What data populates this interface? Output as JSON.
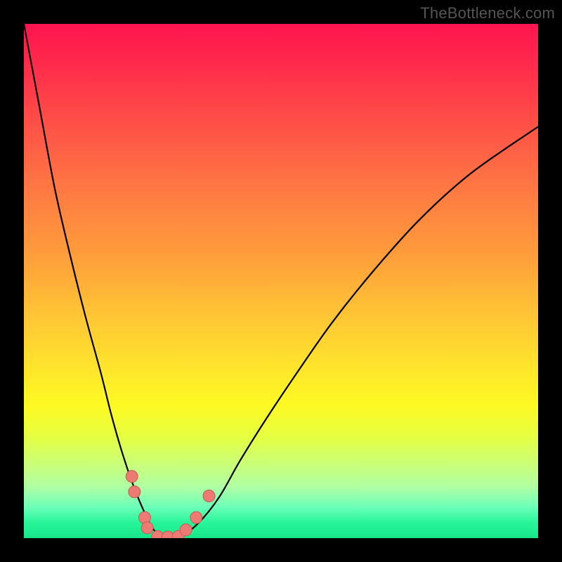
{
  "watermark": "TheBottleneck.com",
  "colors": {
    "page_bg": "#000000",
    "gradient_top": "#ff144f",
    "gradient_bottom": "#16e789",
    "curve": "#000000",
    "marker_fill": "#ed7b74",
    "marker_stroke": "#c85a55",
    "watermark": "#555555"
  },
  "chart_data": {
    "type": "line",
    "title": "",
    "xlabel": "",
    "ylabel": "",
    "xlim": [
      0,
      100
    ],
    "ylim": [
      0,
      100
    ],
    "grid": false,
    "series": [
      {
        "name": "bottleneck-curve",
        "x": [
          0,
          3,
          6,
          9,
          12,
          15,
          17,
          19,
          21,
          23,
          25,
          27,
          30,
          34,
          38,
          42,
          47,
          53,
          60,
          68,
          77,
          87,
          100
        ],
        "values": [
          100,
          84,
          68,
          55,
          43,
          32,
          24,
          17,
          11,
          6,
          2,
          0,
          0,
          3,
          8,
          15,
          23,
          32,
          42,
          52,
          62,
          71,
          80
        ]
      }
    ],
    "markers": [
      {
        "x": 21.0,
        "y": 12.0
      },
      {
        "x": 21.5,
        "y": 9.0
      },
      {
        "x": 23.5,
        "y": 4.0
      },
      {
        "x": 24.0,
        "y": 2.0
      },
      {
        "x": 26.0,
        "y": 0.3
      },
      {
        "x": 28.0,
        "y": 0.2
      },
      {
        "x": 30.0,
        "y": 0.3
      },
      {
        "x": 31.5,
        "y": 1.6
      },
      {
        "x": 33.5,
        "y": 4.0
      },
      {
        "x": 36.0,
        "y": 8.2
      }
    ]
  }
}
